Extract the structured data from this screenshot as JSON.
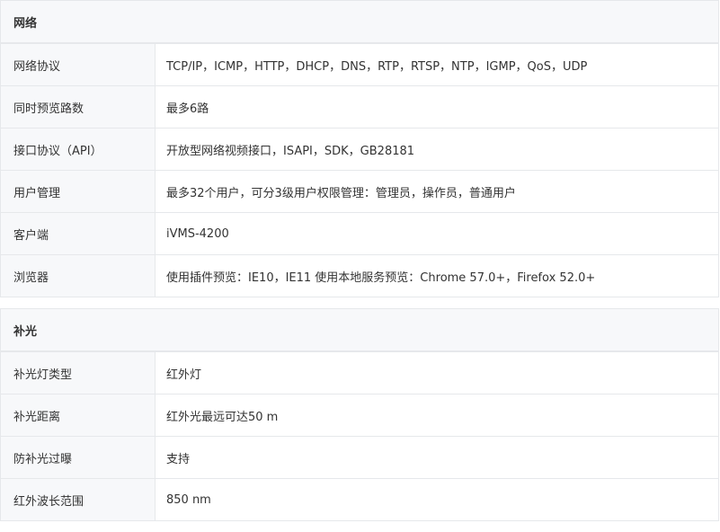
{
  "sections": [
    {
      "title": "网络",
      "rows": [
        {
          "label": "网络协议",
          "value": "TCP/IP，ICMP，HTTP，DHCP，DNS，RTP，RTSP，NTP，IGMP，QoS，UDP"
        },
        {
          "label": "同时预览路数",
          "value": "最多6路"
        },
        {
          "label": "接口协议（API）",
          "value": "开放型网络视频接口，ISAPI，SDK，GB28181"
        },
        {
          "label": "用户管理",
          "value": "最多32个用户，可分3级用户权限管理：管理员，操作员，普通用户"
        },
        {
          "label": "客户端",
          "value": "iVMS-4200"
        },
        {
          "label": "浏览器",
          "value": "使用插件预览：IE10，IE11 使用本地服务预览：Chrome 57.0+，Firefox 52.0+"
        }
      ]
    },
    {
      "title": "补光",
      "rows": [
        {
          "label": "补光灯类型",
          "value": "红外灯"
        },
        {
          "label": "补光距离",
          "value": "红外光最远可达50 m"
        },
        {
          "label": "防补光过曝",
          "value": "支持"
        },
        {
          "label": "红外波长范围",
          "value": "850 nm"
        }
      ]
    }
  ]
}
